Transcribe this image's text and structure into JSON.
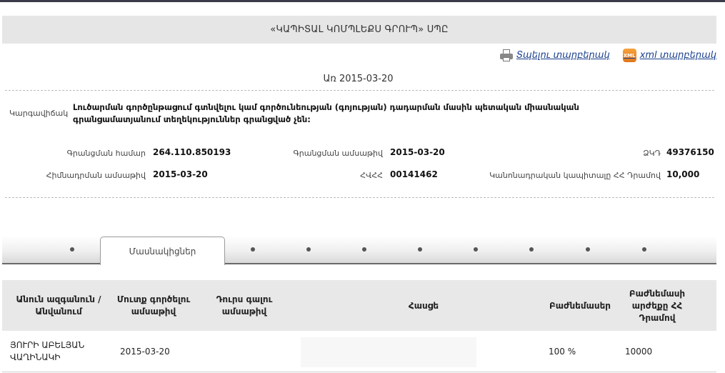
{
  "company": {
    "title": "«ԿԱՊԻՏԱԼ ԿՈՄՊԼԵՔՍ ԳՐՈՒՊ» ՍՊԸ"
  },
  "actions": {
    "print_label": "Տպելու տարբերակ",
    "xml_label": "xml տարբերակ",
    "xml_icon_text": "XML"
  },
  "as_of": "Առ 2015-03-20",
  "status": {
    "label": "Կարգավիճակ",
    "text": "Լուծարման գործընթացում գտնվելու կամ գործունեության (գոյության) դադարման մասին պետական միասնական գրանցամատյանում տեղեկություններ գրանցված չեն:"
  },
  "details": {
    "reg_number_label": "Գրանցման համար",
    "reg_number": "264.110.850193",
    "reg_date_label": "Գրանցման ամսաթիվ",
    "reg_date": "2015-03-20",
    "tax_label": "ՀՎՀՀ",
    "tax_id": "00141462",
    "zkd_label": "ՁԿԴ",
    "zkd": "49376150",
    "founding_date_label": "Հիմնադրման ամսաթիվ",
    "founding_date": "2015-03-20",
    "capital_label": "Կանոնադրական կապիտալը ՀՀ Դրամով",
    "capital": "10,000"
  },
  "tabs": {
    "active_label": "Մասնակիցներ"
  },
  "table": {
    "headers": {
      "name": "Անուն ազգանուն / Անվանում",
      "entry_date": "Մուտք գործելու ամսաթիվ",
      "exit_date": "Դուրս գալու ամսաթիվ",
      "address": "Հասցե",
      "shares": "Բաժնեմասեր",
      "share_value": "Բաժնեմասի արժեքը ՀՀ Դրամով"
    },
    "rows": [
      {
        "name": "ՅՈՒՐԻ ԱԲԵԼՅԱՆ ՎԱՂԻՆԱԿԻ",
        "entry_date": "2015-03-20",
        "exit_date": "",
        "address": "",
        "shares": "100 %",
        "share_value": "10000"
      }
    ]
  }
}
